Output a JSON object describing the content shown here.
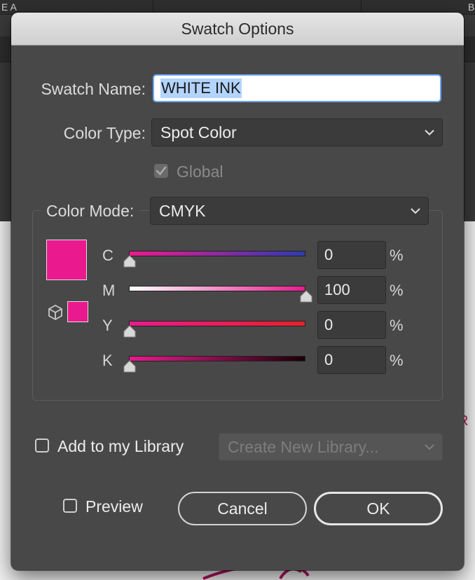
{
  "background": {
    "tab_left_fragment": "E A",
    "tab_right_fragment": "B",
    "canvas_letter": "R"
  },
  "dialog": {
    "title": "Swatch Options",
    "swatch_name": {
      "label": "Swatch Name:",
      "value": "WHITE INK"
    },
    "color_type": {
      "label": "Color Type:",
      "value": "Spot Color"
    },
    "global": {
      "label": "Global",
      "checked": true,
      "enabled": false
    },
    "color_mode": {
      "label": "Color Mode:",
      "value": "CMYK"
    },
    "swatch_color": "#ea1a8e",
    "channels": [
      {
        "label": "C",
        "value": "0",
        "unit": "%",
        "level": 0
      },
      {
        "label": "M",
        "value": "100",
        "unit": "%",
        "level": 100
      },
      {
        "label": "Y",
        "value": "0",
        "unit": "%",
        "level": 0
      },
      {
        "label": "K",
        "value": "0",
        "unit": "%",
        "level": 0
      }
    ],
    "library": {
      "label": "Add to my Library",
      "checked": false,
      "select_value": "Create New Library...",
      "select_enabled": false
    },
    "preview": {
      "label": "Preview",
      "checked": false
    },
    "buttons": {
      "cancel": "Cancel",
      "ok": "OK"
    }
  },
  "colors": {
    "dialog_bg": "#484848",
    "field_bg": "#3b3b3b",
    "focus_ring": "#6aa3f2",
    "selection": "#b3d4fd",
    "magenta": "#ea1a8e"
  },
  "icons": [
    "chevron-down-icon",
    "checkmark-icon",
    "cube-icon",
    "slider-thumb-icon"
  ]
}
